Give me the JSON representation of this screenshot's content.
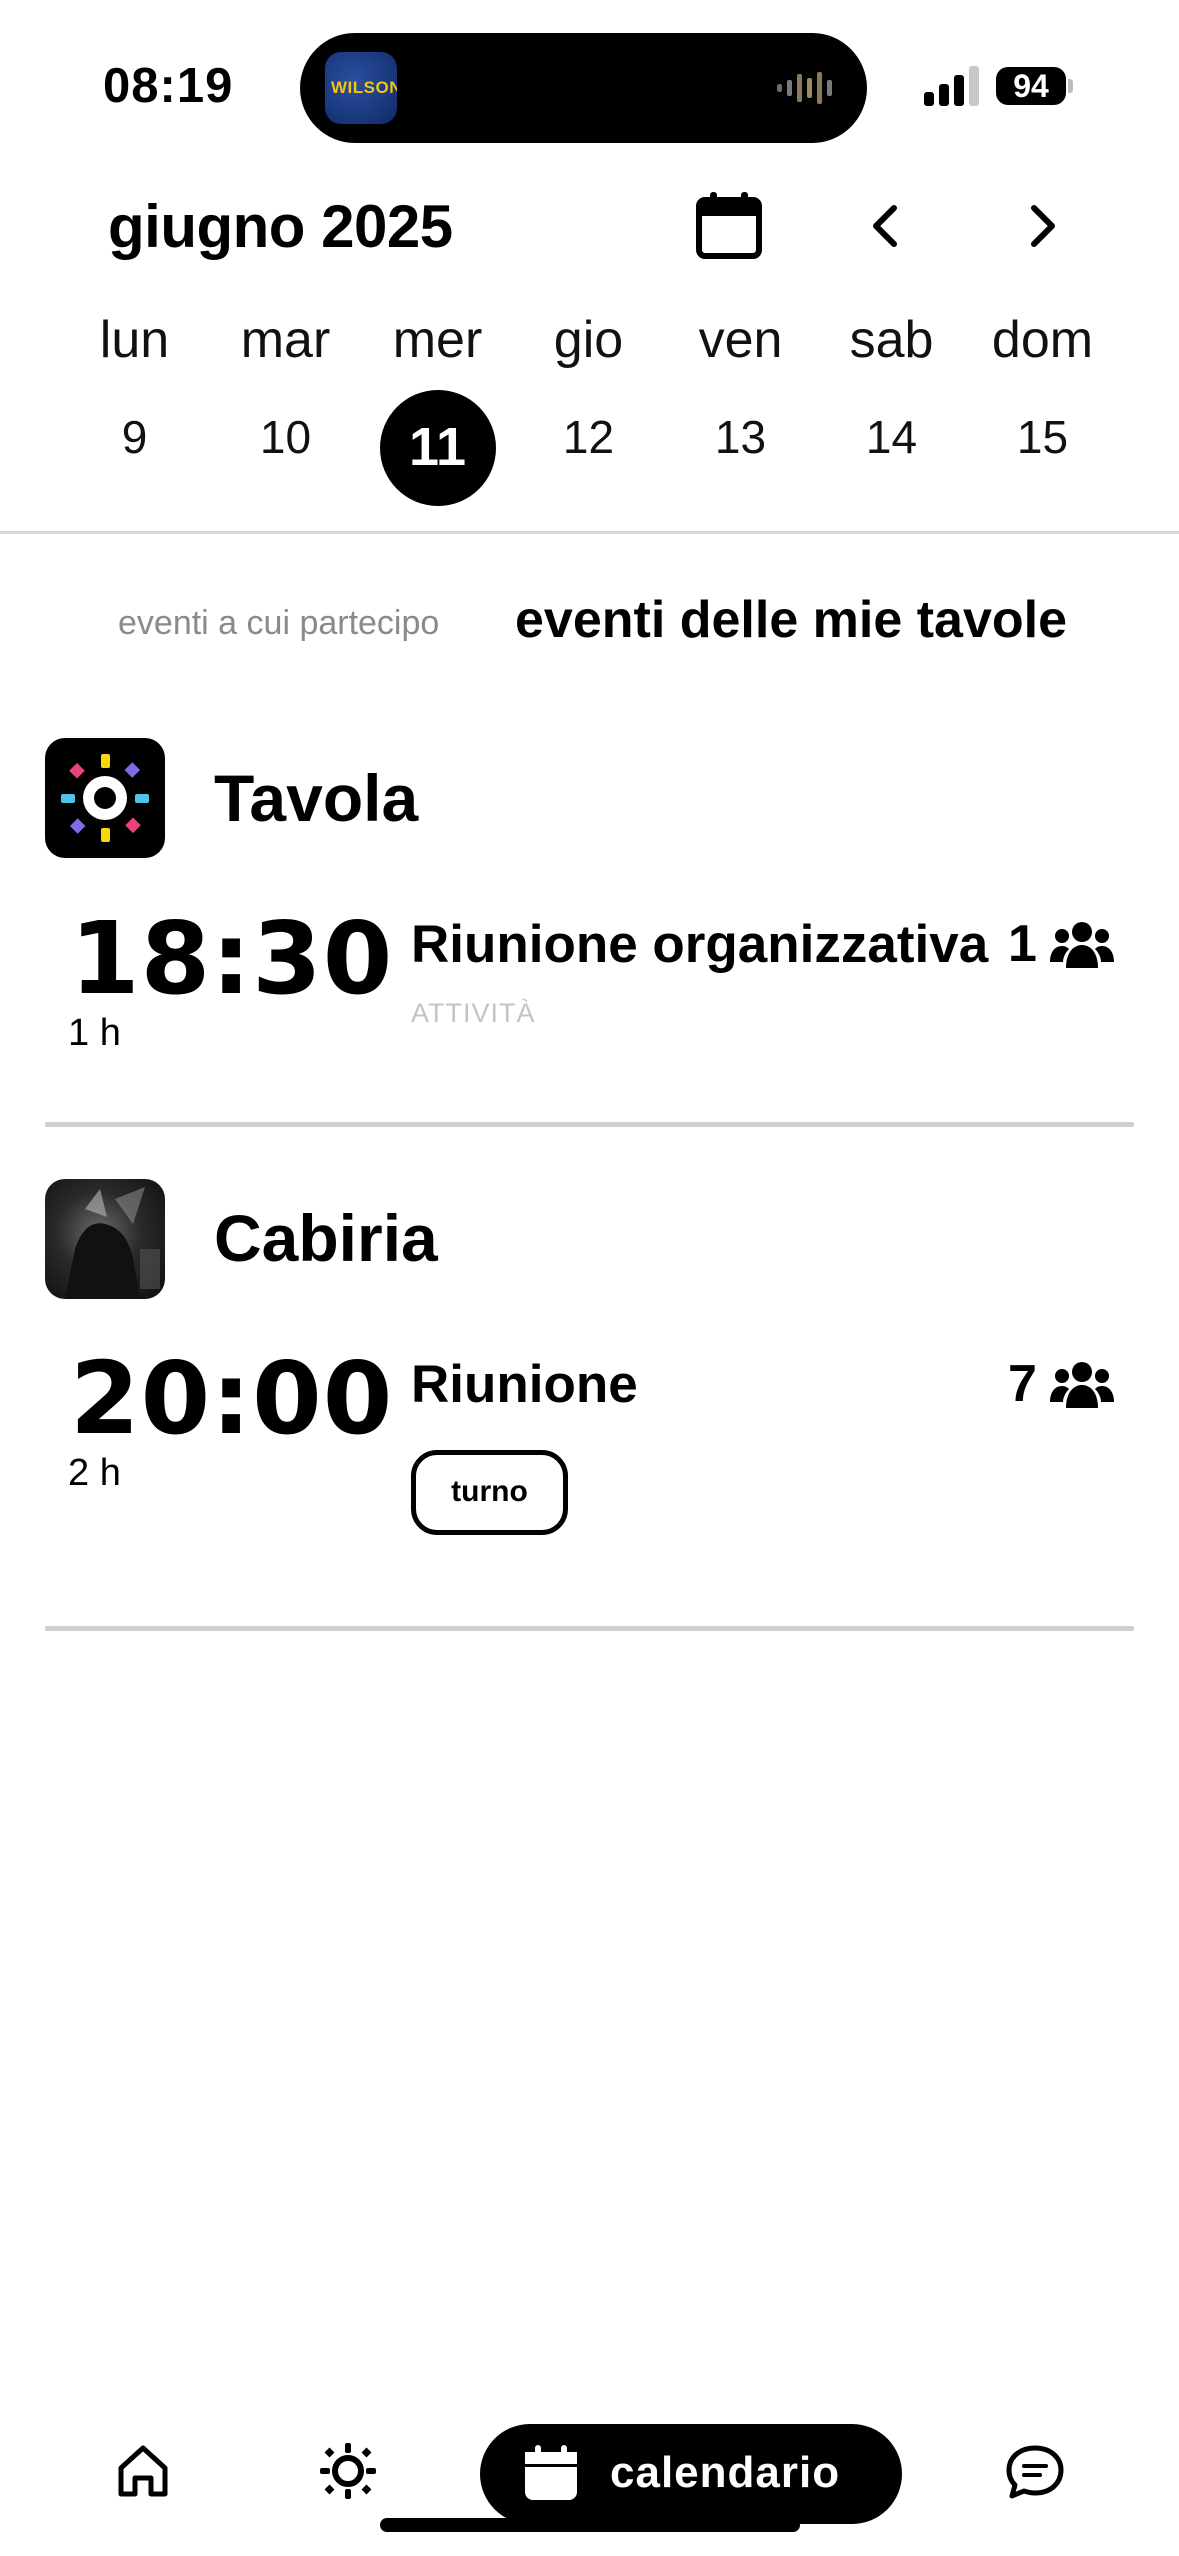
{
  "status_bar": {
    "time": "08:19",
    "battery": "94",
    "live_activity_app": "WILSON"
  },
  "header": {
    "month_title": "giugno 2025"
  },
  "week": {
    "days": [
      {
        "name": "lun",
        "num": "9"
      },
      {
        "name": "mar",
        "num": "10"
      },
      {
        "name": "mer",
        "num": "11"
      },
      {
        "name": "gio",
        "num": "12"
      },
      {
        "name": "ven",
        "num": "13"
      },
      {
        "name": "sab",
        "num": "14"
      },
      {
        "name": "dom",
        "num": "15"
      }
    ],
    "selected_index": 2
  },
  "tabs": {
    "participating": "eventi a cui partecipo",
    "my_tables": "eventi delle mie tavole",
    "active": "my_tables"
  },
  "groups": [
    {
      "name": "Tavola",
      "logo_icon": "tavola-sun-logo",
      "event": {
        "time": "18:30",
        "duration": "1 h",
        "title": "Riunione organizzativa",
        "subtitle": "ATTIVITÀ",
        "participants": "1"
      }
    },
    {
      "name": "Cabiria",
      "logo_icon": "cabiria-photo-logo",
      "event": {
        "time": "20:00",
        "duration": "2 h",
        "title": "Riunione",
        "badge": "turno",
        "participants": "7"
      }
    }
  ],
  "bottom_nav": {
    "items": [
      "home-icon",
      "sun-icon",
      "calendar-icon",
      "chat-icon"
    ],
    "active_label": "calendario"
  },
  "colors": {
    "accent": "#000000",
    "divider": "#d8d8d8",
    "muted_text": "#8a8a8a"
  }
}
